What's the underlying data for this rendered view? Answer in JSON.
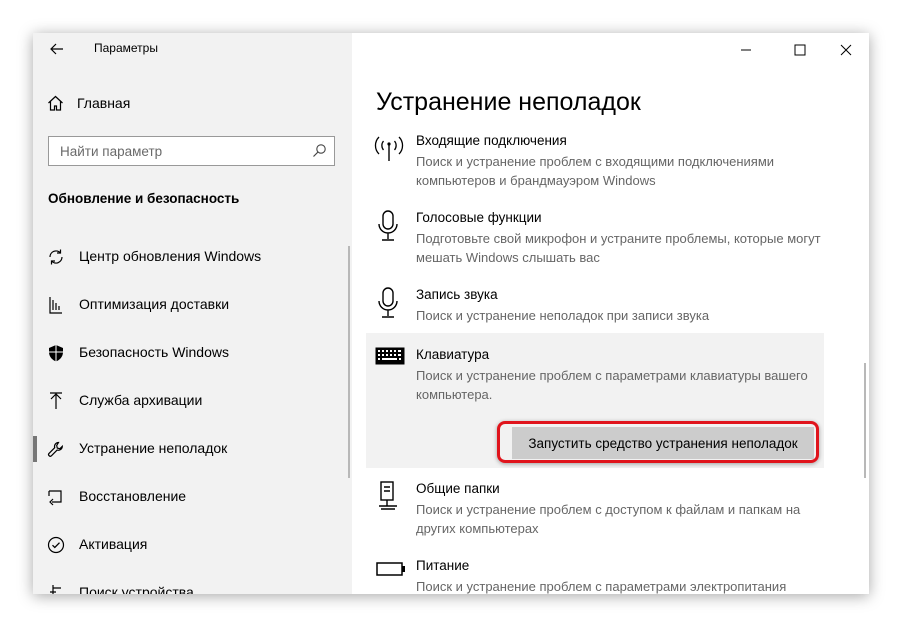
{
  "window": {
    "title": "Параметры"
  },
  "sidebar": {
    "home_label": "Главная",
    "search_placeholder": "Найти параметр",
    "section_title": "Обновление и безопасность",
    "items": [
      {
        "label": "Центр обновления Windows",
        "icon": "refresh-icon"
      },
      {
        "label": "Оптимизация доставки",
        "icon": "delivery-icon"
      },
      {
        "label": "Безопасность Windows",
        "icon": "shield-icon"
      },
      {
        "label": "Служба архивации",
        "icon": "upload-icon"
      },
      {
        "label": "Устранение неполадок",
        "icon": "wrench-icon",
        "active": true
      },
      {
        "label": "Восстановление",
        "icon": "recovery-icon"
      },
      {
        "label": "Активация",
        "icon": "check-circle-icon"
      },
      {
        "label": "Поиск устройства",
        "icon": "find-device-icon"
      }
    ]
  },
  "main": {
    "title": "Устранение неполадок",
    "items": [
      {
        "name": "Входящие подключения",
        "desc": "Поиск и устранение проблем с входящими подключениями компьютеров и брандмауэром Windows",
        "icon": "antenna-icon"
      },
      {
        "name": "Голосовые функции",
        "desc": "Подготовьте свой микрофон и устраните проблемы, которые могут мешать Windows слышать вас",
        "icon": "microphone-icon"
      },
      {
        "name": "Запись звука",
        "desc": "Поиск и устранение неполадок при записи звука",
        "icon": "microphone-icon"
      },
      {
        "name": "Клавиатура",
        "desc": "Поиск и устранение проблем с параметрами клавиатуры вашего компьютера.",
        "icon": "keyboard-icon",
        "selected": true
      },
      {
        "name": "Общие папки",
        "desc": "Поиск и устранение проблем с доступом к файлам и папкам на других компьютерах",
        "icon": "shared-folder-icon"
      },
      {
        "name": "Питание",
        "desc": "Поиск и устранение проблем с параметрами электропитания",
        "icon": "battery-icon"
      }
    ],
    "run_button": "Запустить средство устранения неполадок"
  },
  "colors": {
    "highlight": "#e0141c",
    "sidebar_bg": "#f2f2f2",
    "button_bg": "#cccccc"
  }
}
